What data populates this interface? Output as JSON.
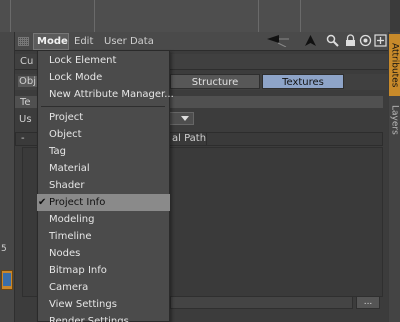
{
  "menubar": {
    "items": [
      "Mode",
      "Edit",
      "User Data"
    ]
  },
  "toolbar": {
    "icons": [
      "arrow-left-icon",
      "arrow-up-icon",
      "search-icon",
      "lock-icon",
      "target-icon",
      "add-icon"
    ]
  },
  "tabs": {
    "structure": "Structure",
    "textures": "Textures"
  },
  "partial_labels": {
    "cu": "Cu",
    "obj": "Obj",
    "te": "Te",
    "us": "Us",
    "dash": "-",
    "path_header": "al Path",
    "left_number": "5"
  },
  "side_tabs": {
    "attributes": "Attributes",
    "layers": "Layers"
  },
  "dropdown_menu": {
    "group1": [
      "Lock Element",
      "Lock Mode",
      "New Attribute Manager..."
    ],
    "group2": [
      "Project",
      "Object",
      "Tag",
      "Material",
      "Shader",
      "Project Info",
      "Modeling",
      "Timeline",
      "Nodes",
      "Bitmap Info",
      "Camera",
      "View Settings",
      "Render Settings"
    ],
    "checked_item": "Project Info"
  },
  "bottom_button": "..."
}
